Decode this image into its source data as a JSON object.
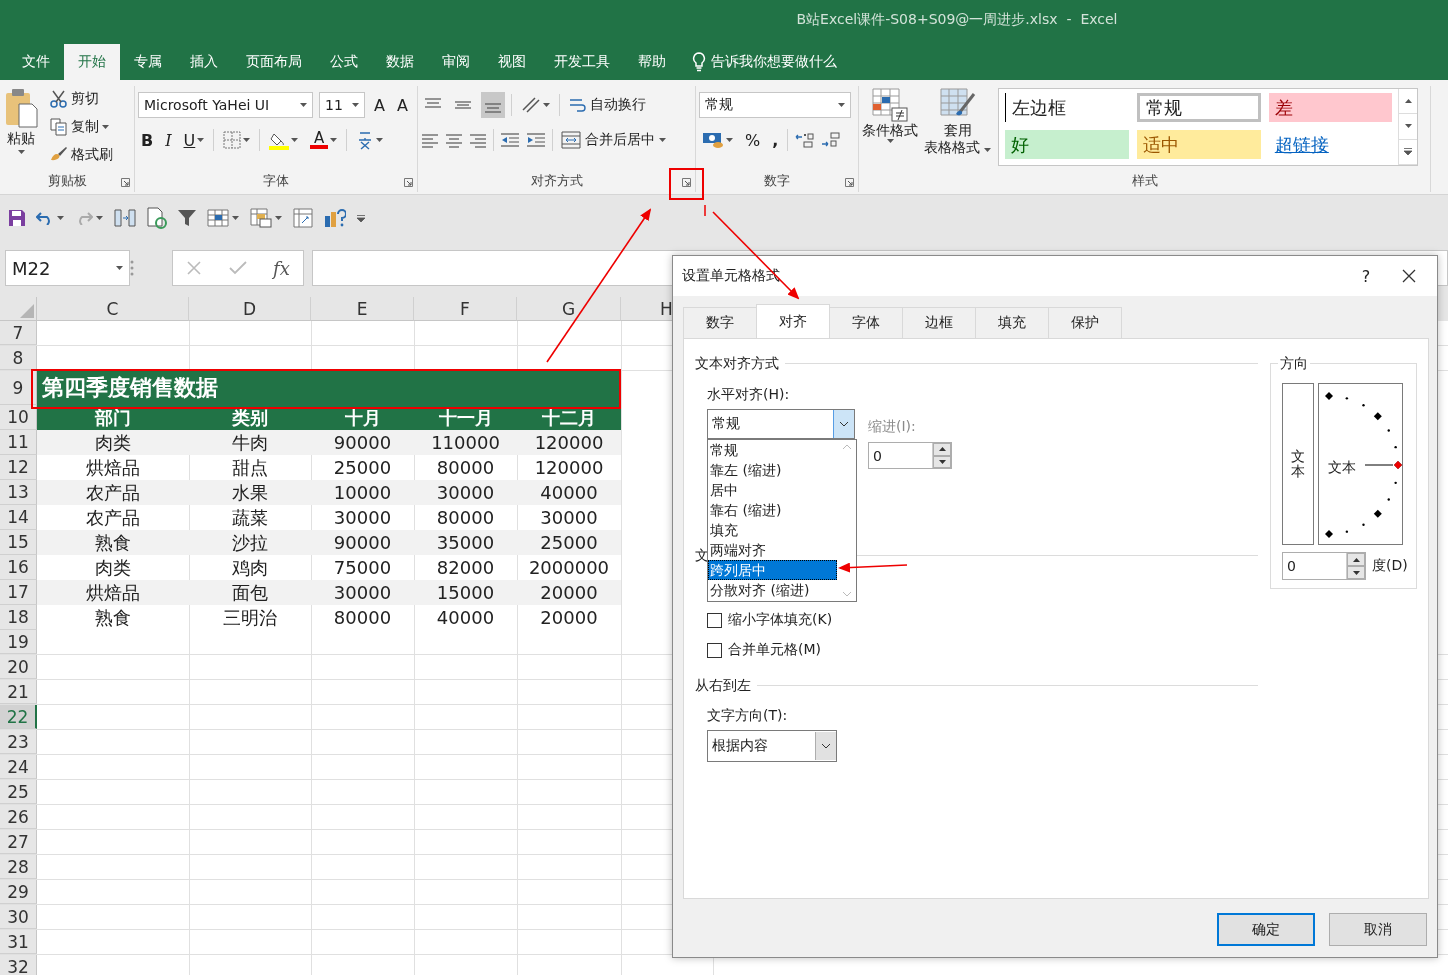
{
  "window": {
    "title": "B站Excel课件-S08+S09@一周进步.xlsx  -  Excel"
  },
  "ribbon_tabs": [
    {
      "label": "文件",
      "selected": false
    },
    {
      "label": "开始",
      "selected": true
    },
    {
      "label": "专属",
      "selected": false
    },
    {
      "label": "插入",
      "selected": false
    },
    {
      "label": "页面布局",
      "selected": false
    },
    {
      "label": "公式",
      "selected": false
    },
    {
      "label": "数据",
      "selected": false
    },
    {
      "label": "审阅",
      "selected": false
    },
    {
      "label": "视图",
      "selected": false
    },
    {
      "label": "开发工具",
      "selected": false
    },
    {
      "label": "帮助",
      "selected": false
    }
  ],
  "tell_me": "告诉我你想要做什么",
  "ribbon": {
    "clipboard": {
      "label": "剪贴板",
      "paste": "粘贴",
      "cut": "剪切",
      "copy": "复制",
      "format_painter": "格式刷"
    },
    "font": {
      "label": "字体",
      "font_name": "Microsoft YaHei UI",
      "font_size": "11",
      "grow": "A",
      "shrink": "A",
      "bold": "B",
      "italic": "I",
      "underline": "U",
      "font_color": "A"
    },
    "alignment": {
      "label": "对齐方式",
      "vertical": [
        {
          "kind": "top",
          "selected": false
        },
        {
          "kind": "middle",
          "selected": false
        },
        {
          "kind": "bottom",
          "selected": true
        }
      ],
      "wrap_text": "自动换行",
      "merge_center": "合并后居中"
    },
    "number": {
      "label": "数字",
      "format": "常规",
      "percent": "%",
      "comma": ","
    },
    "styles": {
      "label": "样式",
      "conditional": "条件格式",
      "table_format": [
        "套用",
        "表格格式"
      ],
      "gallery": [
        {
          "label": "左边框",
          "kind": "plain"
        },
        {
          "label": "常规",
          "kind": "normal"
        },
        {
          "label": "差",
          "kind": "bad"
        },
        {
          "label": "好",
          "kind": "good"
        },
        {
          "label": "适中",
          "kind": "neutral"
        },
        {
          "label": "超链接",
          "kind": "link"
        }
      ]
    }
  },
  "name_box": "M22",
  "fx": "fx",
  "sheet": {
    "columns": [
      "C",
      "D",
      "E",
      "F",
      "G",
      "H"
    ],
    "rows_above": [
      {
        "number": "7",
        "selected": false
      },
      {
        "number": "8",
        "selected": false
      }
    ],
    "title_row": {
      "number": "9",
      "selected": false,
      "text": "第四季度销售数据"
    },
    "header_row": {
      "number": "10",
      "selected": false,
      "cells": [
        "部门",
        "类别",
        "十月",
        "十一月",
        "十二月"
      ]
    },
    "data_rows": [
      {
        "number": "11",
        "selected": false,
        "cells": [
          "肉类",
          "牛肉",
          "90000",
          "110000",
          "120000"
        ]
      },
      {
        "number": "12",
        "selected": false,
        "cells": [
          "烘焙品",
          "甜点",
          "25000",
          "80000",
          "120000"
        ]
      },
      {
        "number": "13",
        "selected": false,
        "cells": [
          "农产品",
          "水果",
          "10000",
          "30000",
          "40000"
        ]
      },
      {
        "number": "14",
        "selected": false,
        "cells": [
          "农产品",
          "蔬菜",
          "30000",
          "80000",
          "30000"
        ]
      },
      {
        "number": "15",
        "selected": false,
        "cells": [
          "熟食",
          "沙拉",
          "90000",
          "35000",
          "25000"
        ]
      },
      {
        "number": "16",
        "selected": false,
        "cells": [
          "肉类",
          "鸡肉",
          "75000",
          "82000",
          "2000000"
        ]
      },
      {
        "number": "17",
        "selected": false,
        "cells": [
          "烘焙品",
          "面包",
          "30000",
          "15000",
          "20000"
        ]
      },
      {
        "number": "18",
        "selected": false,
        "cells": [
          "熟食",
          "三明治",
          "80000",
          "40000",
          "20000"
        ]
      }
    ],
    "rows_below": [
      {
        "number": "19",
        "selected": false
      },
      {
        "number": "20",
        "selected": false
      },
      {
        "number": "21",
        "selected": false
      },
      {
        "number": "22",
        "selected": true
      },
      {
        "number": "23",
        "selected": false
      },
      {
        "number": "24",
        "selected": false
      },
      {
        "number": "25",
        "selected": false
      },
      {
        "number": "26",
        "selected": false
      },
      {
        "number": "27",
        "selected": false
      },
      {
        "number": "28",
        "selected": false
      },
      {
        "number": "29",
        "selected": false
      },
      {
        "number": "30",
        "selected": false
      },
      {
        "number": "31",
        "selected": false
      },
      {
        "number": "32",
        "selected": false
      }
    ]
  },
  "dialog": {
    "title": "设置单元格格式",
    "help": "?",
    "tabs": [
      {
        "label": "数字",
        "selected": false
      },
      {
        "label": "对齐",
        "selected": true
      },
      {
        "label": "字体",
        "selected": false
      },
      {
        "label": "边框",
        "selected": false
      },
      {
        "label": "填充",
        "selected": false
      },
      {
        "label": "保护",
        "selected": false
      }
    ],
    "text_alignment": {
      "label": "文本对齐方式",
      "horizontal_label": "水平对齐(H):",
      "horizontal_value": "常规",
      "options": [
        {
          "label": "常规",
          "selected": false
        },
        {
          "label": "靠左 (缩进)",
          "selected": false
        },
        {
          "label": "居中",
          "selected": false
        },
        {
          "label": "靠右 (缩进)",
          "selected": false
        },
        {
          "label": "填充",
          "selected": false
        },
        {
          "label": "两端对齐",
          "selected": false
        },
        {
          "label": "跨列居中",
          "selected": true
        },
        {
          "label": "分散对齐 (缩进)",
          "selected": false
        }
      ],
      "indent_label": "缩进(I):",
      "indent_value": "0"
    },
    "text_control": {
      "label": "文",
      "shrink_to_fit": {
        "label": "缩小字体填充(K)",
        "checked": false
      },
      "merge_cells": {
        "label": "合并单元格(M)",
        "checked": false
      }
    },
    "right_to_left": {
      "label": "从右到左",
      "direction_label": "文字方向(T):",
      "direction_value": "根据内容"
    },
    "orientation": {
      "label": "方向",
      "vertical_text": "文本",
      "text": "文本",
      "degrees_value": "0",
      "degrees_label": "度(D)"
    },
    "buttons": [
      {
        "label": "确定",
        "default": true
      },
      {
        "label": "取消",
        "default": false
      }
    ]
  }
}
